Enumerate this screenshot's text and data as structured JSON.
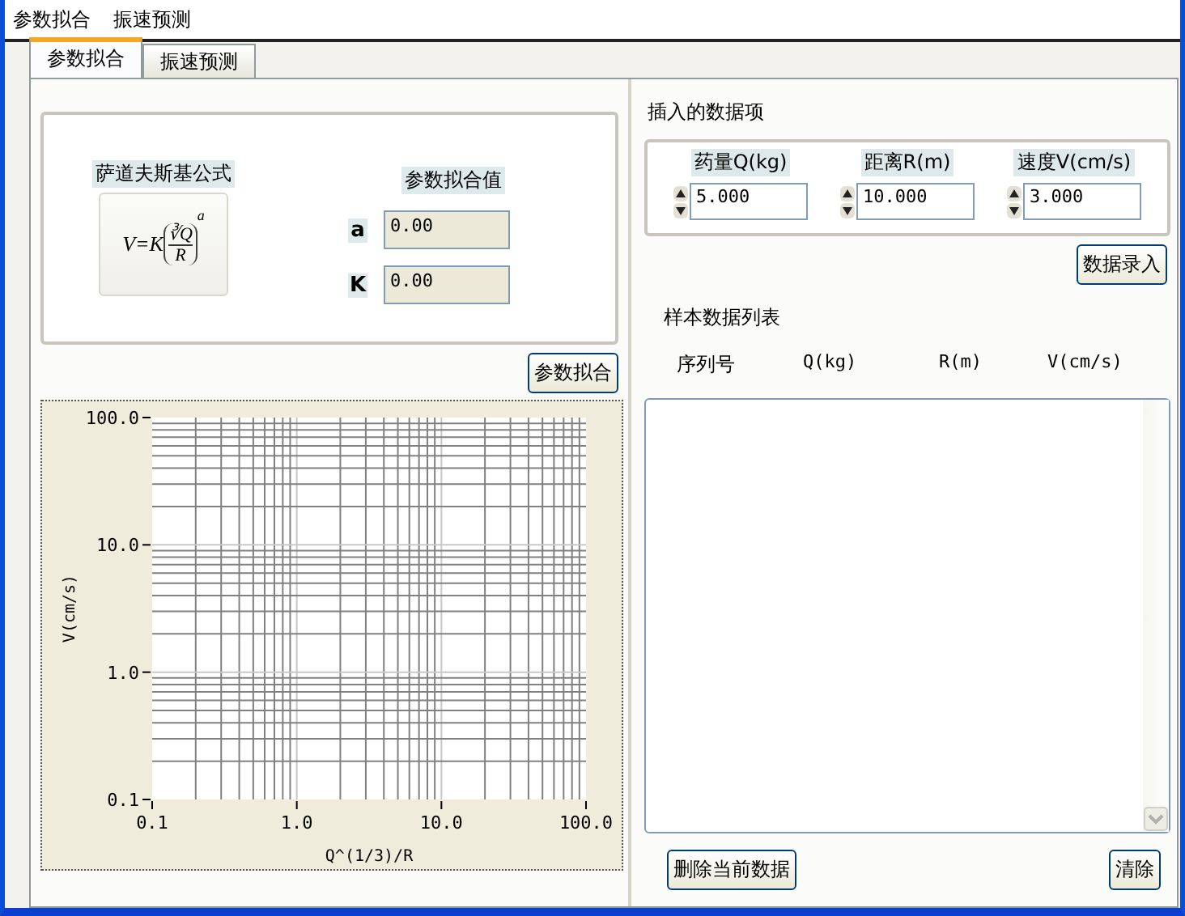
{
  "menu": [
    {
      "label": "参数拟合"
    },
    {
      "label": "振速预测"
    }
  ],
  "tabs": [
    {
      "label": "参数拟合",
      "selected": true
    },
    {
      "label": "振速预测",
      "selected": false
    }
  ],
  "formula_panel": {
    "title": "萨道夫斯基公式",
    "formula": {
      "lhs": "V=K",
      "numerator": "∛Q",
      "denominator": "R",
      "exponent": "a"
    }
  },
  "fit_values": {
    "title": "参数拟合值",
    "params": [
      {
        "label": "a",
        "value": "0.00"
      },
      {
        "label": "K",
        "value": "0.00"
      }
    ]
  },
  "fit_button": "参数拟合",
  "chart": {
    "x_axis_title": "Q^(1/3)/R",
    "y_axis_title": "V(cm/s)",
    "x_tick_labels": [
      "0.1",
      "1.0",
      "10.0",
      "100.0"
    ],
    "y_tick_labels": [
      "100.0",
      "10.0",
      "1.0",
      "0.1"
    ]
  },
  "insert": {
    "title": "插入的数据项",
    "fields": [
      {
        "label": "药量Q(kg)",
        "value": "5.000"
      },
      {
        "label": "距离R(m)",
        "value": "10.000"
      },
      {
        "label": "速度V(cm/s)",
        "value": "3.000"
      }
    ],
    "button": "数据录入"
  },
  "samples": {
    "title": "样本数据列表",
    "columns": [
      "序列号",
      "Q(kg)",
      "R(m)",
      "V(cm/s)"
    ],
    "delete_button": "删除当前数据",
    "clear_button": "清除"
  }
}
